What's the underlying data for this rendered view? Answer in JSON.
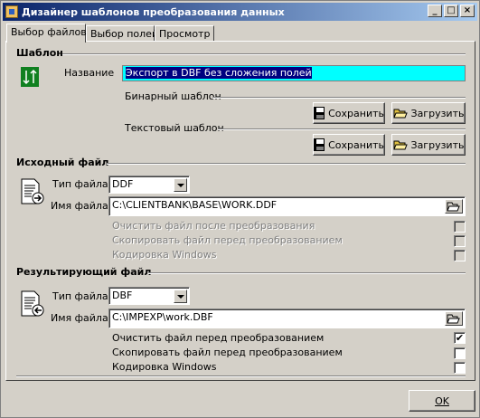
{
  "window": {
    "title": "Дизайнер шаблонов преобразования данных"
  },
  "tabs": [
    {
      "label": "Выбор файлов"
    },
    {
      "label": "Выбор полей"
    },
    {
      "label": "Просмотр"
    }
  ],
  "template_section": {
    "heading": "Шаблон",
    "name_label": "Название",
    "name_value": "Экспорт в DBF без сложения полей",
    "binary_label": "Бинарный шаблон",
    "text_label": "Текстовый шаблон",
    "save_label": "Сохранить",
    "load_label": "Загрузить"
  },
  "source_section": {
    "heading": "Исходный файл",
    "type_label": "Тип файла",
    "type_value": "DDF",
    "name_label": "Имя файла",
    "name_value": "C:\\CLIENTBANK\\BASE\\WORK.DDF",
    "options": [
      {
        "label": "Очистить файл после преобразования",
        "checked": false
      },
      {
        "label": "Скопировать файл перед преобразованием",
        "checked": false
      },
      {
        "label": "Кодировка Windows",
        "checked": false
      }
    ]
  },
  "result_section": {
    "heading": "Результирующий файл",
    "type_label": "Тип файла",
    "type_value": "DBF",
    "name_label": "Имя файла",
    "name_value": "C:\\IMPEXP\\work.DBF",
    "options": [
      {
        "label": "Очистить файл перед преобразованием",
        "checked": true,
        "mark": "✔"
      },
      {
        "label": "Скопировать файл перед преобразованием",
        "checked": false,
        "mark": ""
      },
      {
        "label": "Кодировка Windows",
        "checked": false,
        "mark": ""
      }
    ]
  },
  "footer": {
    "ok_label": "OK"
  }
}
